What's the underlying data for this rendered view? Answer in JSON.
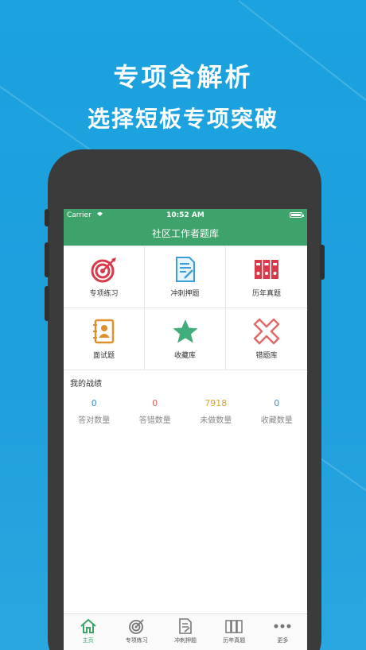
{
  "headline": {
    "line1": "专项含解析",
    "line2": "选择短板专项突破"
  },
  "status_bar": {
    "carrier": "Carrier",
    "time": "10:52 AM"
  },
  "nav": {
    "title": "社区工作者题库"
  },
  "grid": [
    {
      "label": "专项练习",
      "icon": "target-icon"
    },
    {
      "label": "冲刺押题",
      "icon": "document-edit-icon"
    },
    {
      "label": "历年真题",
      "icon": "binders-icon"
    },
    {
      "label": "面试题",
      "icon": "contact-book-icon"
    },
    {
      "label": "收藏库",
      "icon": "star-icon"
    },
    {
      "label": "错题库",
      "icon": "cross-icon"
    }
  ],
  "stats": {
    "title": "我的战绩",
    "items": [
      {
        "value": "0",
        "label": "答对数量",
        "color": "#3a8fd8"
      },
      {
        "value": "0",
        "label": "答错数量",
        "color": "#e25a5a"
      },
      {
        "value": "7918",
        "label": "未做数量",
        "color": "#e3a32a"
      },
      {
        "value": "0",
        "label": "收藏数量",
        "color": "#3a8fd8"
      }
    ]
  },
  "tabs": [
    {
      "label": "主页",
      "active": true
    },
    {
      "label": "专项练习"
    },
    {
      "label": "冲刺押题"
    },
    {
      "label": "历年真题"
    },
    {
      "label": "更多"
    }
  ],
  "colors": {
    "brand_green": "#3da36a",
    "background_blue": "#1aa3df"
  }
}
